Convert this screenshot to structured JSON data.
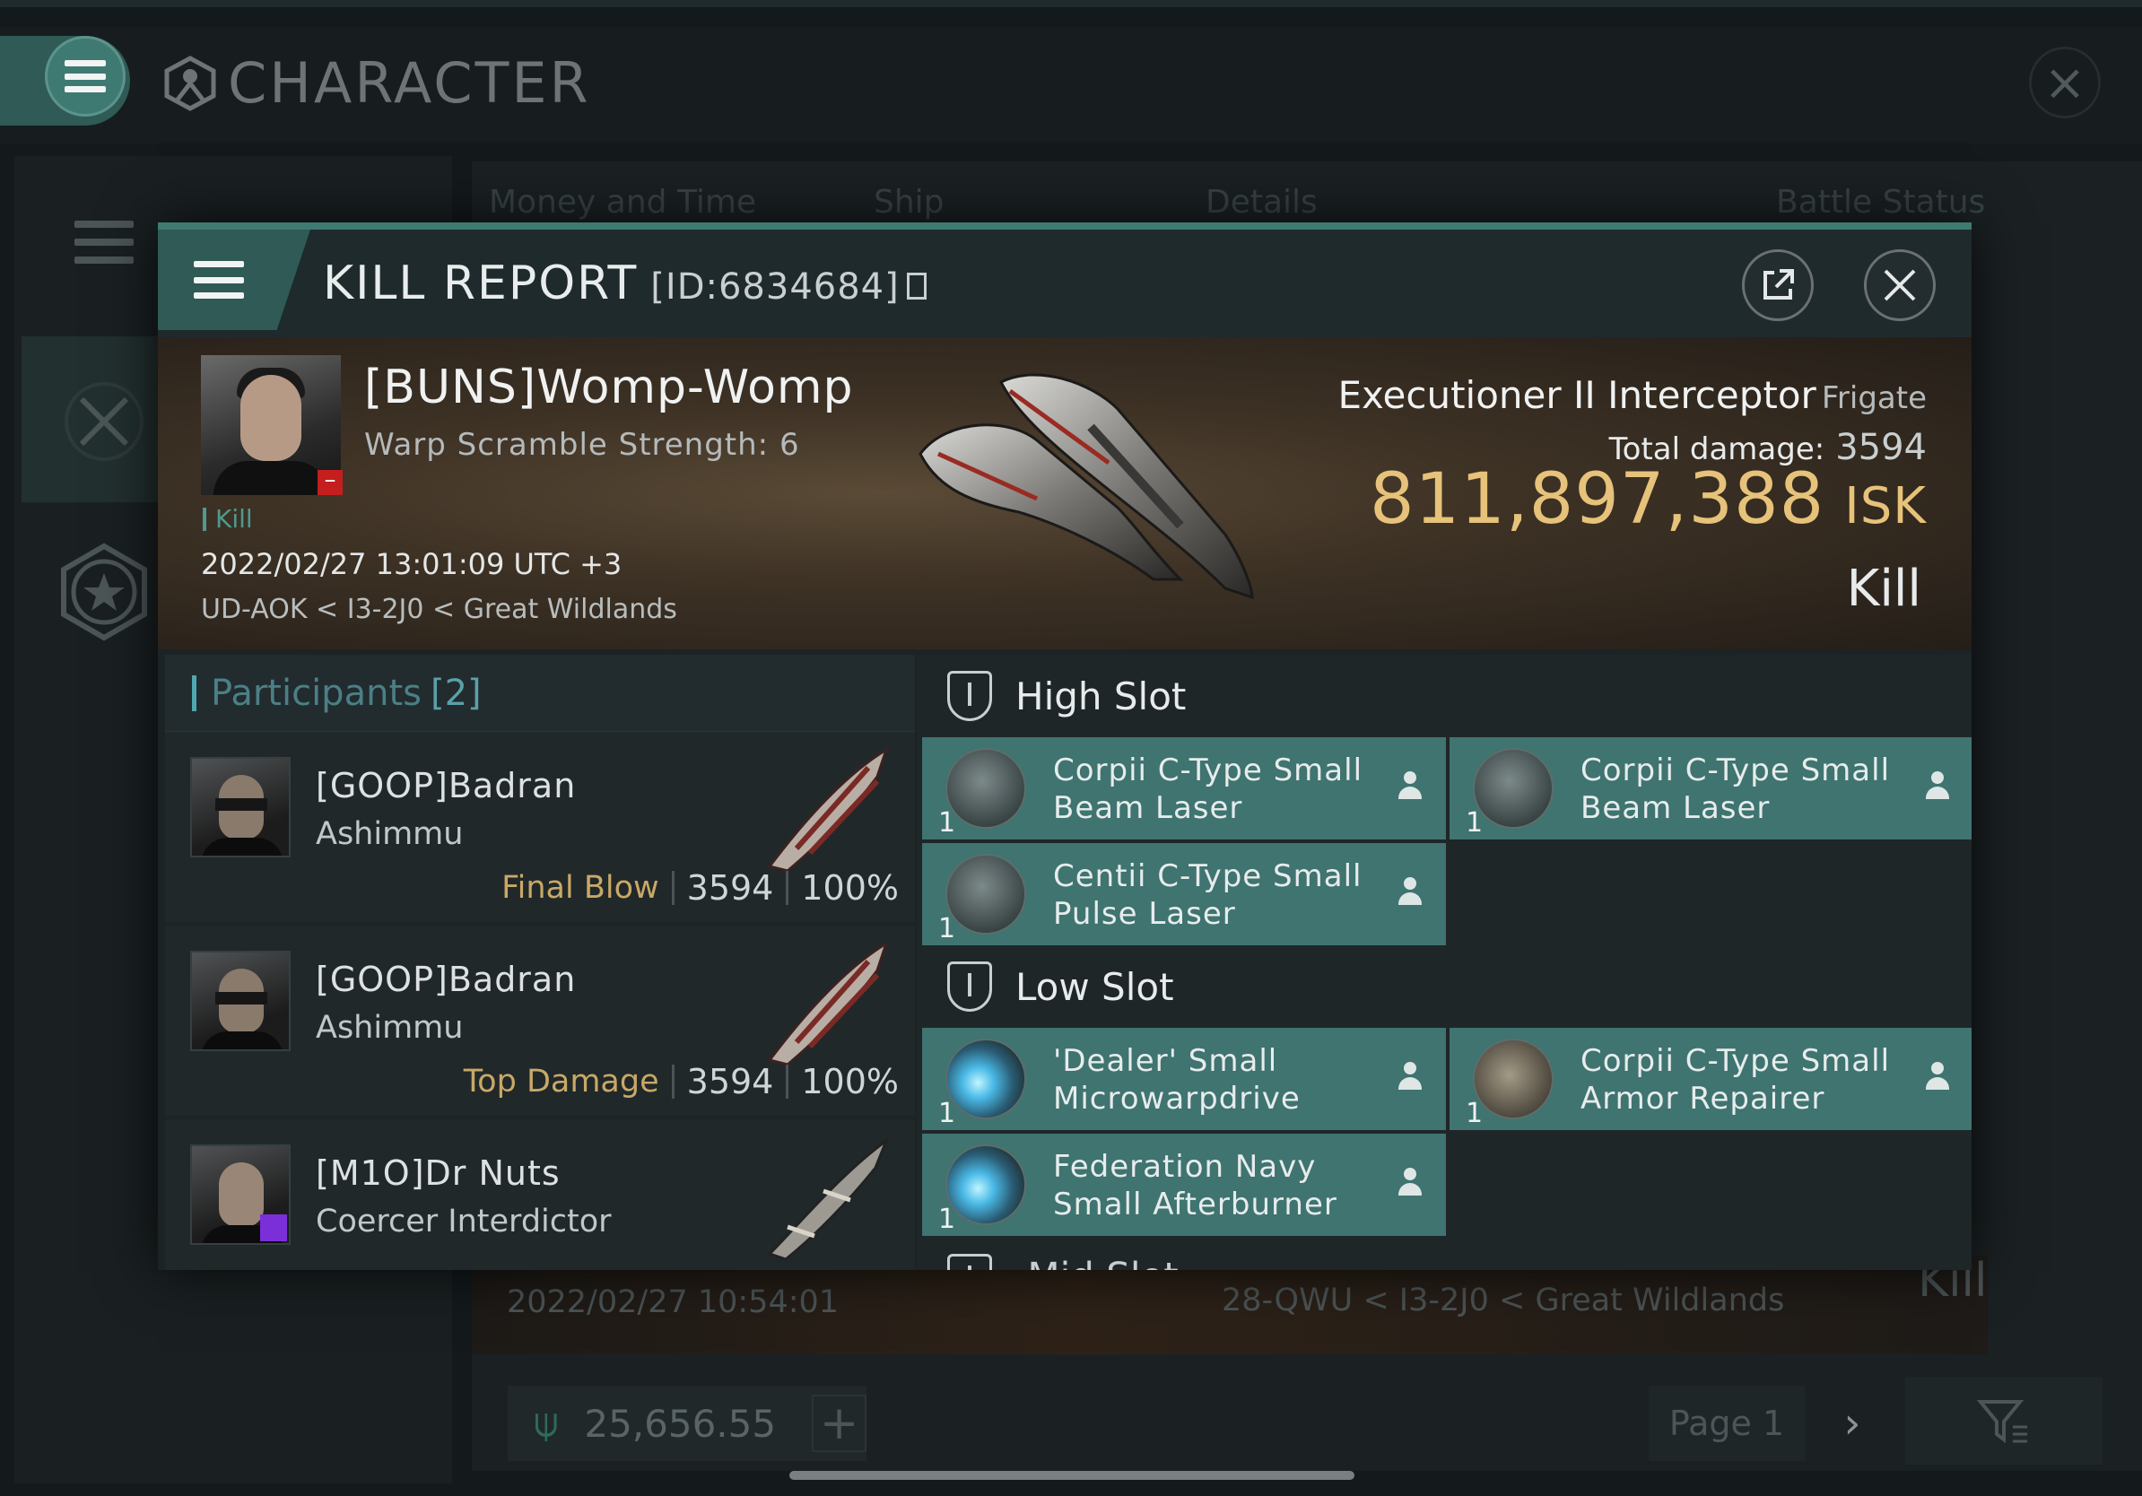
{
  "character_window": {
    "title": "CHARACTER",
    "table_columns": [
      "Money and Time",
      "Ship",
      "Details",
      "Battle Status"
    ],
    "bg_row": {
      "date": "2022/02/27 10:54:01",
      "location": "28-QWU < I3-2J0 < Great Wildlands",
      "status": "Kill"
    },
    "wallet_value": "25,656.55",
    "page_label": "Page 1"
  },
  "kill_report": {
    "title": "KILL REPORT",
    "id": "[ID:6834684]",
    "victim": {
      "name": "[BUNS]Womp-Womp",
      "warp_scramble": "Warp Scramble Strength: 6",
      "tag": "Kill",
      "datetime": "2022/02/27 13:01:09 UTC +3",
      "location": "UD-AOK < I3-2J0 < Great Wildlands"
    },
    "ship": {
      "name": "Executioner II Interceptor",
      "class": "Frigate",
      "total_damage_label": "Total damage:",
      "total_damage": "3594",
      "isk_value": "811,897,388",
      "isk_unit": "ISK",
      "result": "Kill"
    },
    "participants": {
      "label": "Participants",
      "count": "[2]",
      "rows": [
        {
          "name": "[GOOP]Badran",
          "ship": "Ashimmu",
          "tag": "Final Blow",
          "damage": "3594",
          "percent": "100%"
        },
        {
          "name": "[GOOP]Badran",
          "ship": "Ashimmu",
          "tag": "Top Damage",
          "damage": "3594",
          "percent": "100%"
        },
        {
          "name": "[M1O]Dr Nuts",
          "ship": "Coercer Interdictor"
        }
      ]
    },
    "high_slot": {
      "label": "High Slot",
      "modules": [
        {
          "name": "Corpii C-Type Small Beam Laser",
          "qty": "1"
        },
        {
          "name": "Corpii C-Type Small Beam Laser",
          "qty": "1"
        },
        {
          "name": "Centii C-Type Small Pulse Laser",
          "qty": "1"
        }
      ]
    },
    "low_slot": {
      "label": "Low Slot",
      "modules": [
        {
          "name": "'Dealer' Small Microwarpdrive",
          "qty": "1"
        },
        {
          "name": "Corpii C-Type Small Armor Repairer",
          "qty": "1"
        },
        {
          "name": "Federation Navy Small Afterburner",
          "qty": "1"
        }
      ]
    },
    "next_slot_partial": "Mid Slot"
  },
  "colors": {
    "accent": "#3f7a72",
    "module_bg": "#3f7470",
    "isk_gold": "#e6c27a",
    "tag_gold": "#c9a866"
  }
}
